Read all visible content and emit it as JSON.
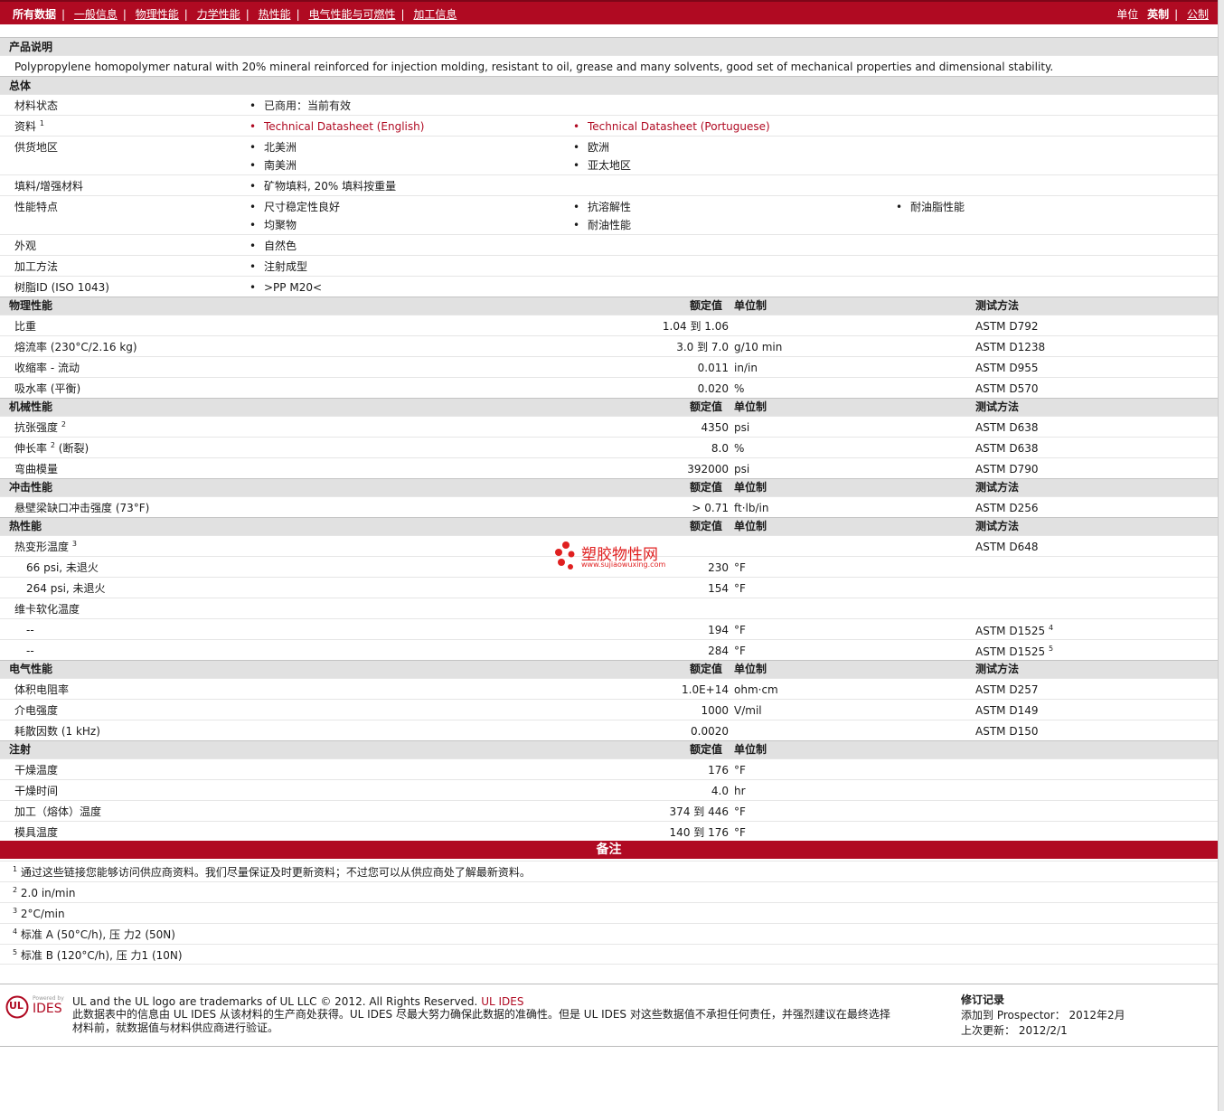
{
  "nav": {
    "all_data": "所有数据",
    "links": [
      "一般信息",
      "物理性能",
      "力学性能",
      "热性能",
      "电气性能与可燃性",
      "加工信息"
    ],
    "unit_label": "单位",
    "unit_english": "英制",
    "unit_metric": "公制"
  },
  "product": {
    "heading": "产品说明",
    "description": "Polypropylene homopolymer natural with 20% mineral reinforced for injection molding, resistant to oil, grease and many solvents, good set of mechanical properties and dimensional stability."
  },
  "general": {
    "heading": "总体",
    "status_label": "材料状态",
    "status": "已商用：当前有效",
    "docs_label": "资料",
    "docs_sup": "1",
    "doc1": "Technical Datasheet (English)",
    "doc2": "Technical Datasheet (Portuguese)",
    "region_label": "供货地区",
    "regions": [
      "北美洲",
      "欧洲",
      "南美洲",
      "亚太地区"
    ],
    "filler_label": "填料/增强材料",
    "filler": "矿物填料, 20% 填料按重量",
    "features_label": "性能特点",
    "features": [
      "尺寸稳定性良好",
      "抗溶解性",
      "耐油脂性能",
      "均聚物",
      "耐油性能"
    ],
    "appearance_label": "外观",
    "appearance": "自然色",
    "method_label": "加工方法",
    "method": "注射成型",
    "resin_label": "树脂ID (ISO 1043)",
    "resin": ">PP M20<"
  },
  "cols": {
    "nominal": "额定值",
    "unit": "单位制",
    "test": "测试方法"
  },
  "physical": {
    "heading": "物理性能",
    "rows": [
      {
        "name": "比重",
        "value": "1.04 到  1.06",
        "unit": "",
        "test": "ASTM D792"
      },
      {
        "name": "熔流率  (230°C/2.16 kg)",
        "value": "3.0 到  7.0",
        "unit": "g/10 min",
        "test": "ASTM D1238"
      },
      {
        "name": "收缩率  - 流动",
        "value": "0.011",
        "unit": "in/in",
        "test": "ASTM D955"
      },
      {
        "name": "吸水率  (平衡)",
        "value": "0.020",
        "unit": "%",
        "test": "ASTM D570"
      }
    ]
  },
  "mechanical": {
    "heading": "机械性能",
    "r1_name": "抗张强度",
    "r1_sup": "2",
    "r1_value": "4350",
    "r1_unit": "psi",
    "r1_test": "ASTM D638",
    "r2_name": "伸长率",
    "r2_sup": "2",
    "r2_suffix": "(断裂)",
    "r2_value": "8.0",
    "r2_unit": "%",
    "r2_test": "ASTM D638",
    "r3_name": "弯曲模量",
    "r3_value": "392000",
    "r3_unit": "psi",
    "r3_test": "ASTM D790"
  },
  "impact": {
    "heading": "冲击性能",
    "name": "悬壁梁缺口冲击强度  (73°F)",
    "value": "> 0.71",
    "unit": "ft·lb/in",
    "test": "ASTM D256"
  },
  "thermal": {
    "heading": "热性能",
    "hdt_name": "热变形温度",
    "hdt_sup": "3",
    "hdt_test": "ASTM D648",
    "hdt1_name": "66 psi, 未退火",
    "hdt1_value": "230",
    "hdt1_unit": "°F",
    "hdt2_name": "264 psi, 未退火",
    "hdt2_value": "154",
    "hdt2_unit": "°F",
    "vicat_name": "维卡软化温度",
    "v1_name": "--",
    "v1_value": "194",
    "v1_unit": "°F",
    "v1_test": "ASTM D1525",
    "v1_sup": "4",
    "v2_name": "--",
    "v2_value": "284",
    "v2_unit": "°F",
    "v2_test": "ASTM D1525",
    "v2_sup": "5"
  },
  "electrical": {
    "heading": "电气性能",
    "rows": [
      {
        "name": "体积电阻率",
        "value": "1.0E+14",
        "unit": "ohm·cm",
        "test": "ASTM D257"
      },
      {
        "name": "介电强度",
        "value": "1000",
        "unit": "V/mil",
        "test": "ASTM D149"
      },
      {
        "name": "耗散因数  (1 kHz)",
        "value": "0.0020",
        "unit": "",
        "test": "ASTM D150"
      }
    ]
  },
  "injection": {
    "heading": "注射",
    "rows": [
      {
        "name": "干燥温度",
        "value": "176",
        "unit": "°F"
      },
      {
        "name": "干燥时间",
        "value": "4.0",
        "unit": "hr"
      },
      {
        "name": "加工（熔体）温度",
        "value": "374 到  446",
        "unit": "°F"
      },
      {
        "name": "模具温度",
        "value": "140 到  176",
        "unit": "°F"
      }
    ]
  },
  "notes": {
    "heading": "备注",
    "items": [
      {
        "sup": "1",
        "text": "通过这些链接您能够访问供应商资料。我们尽量保证及时更新资料；不过您可以从供应商处了解最新资料。"
      },
      {
        "sup": "2",
        "text": "2.0 in/min"
      },
      {
        "sup": "3",
        "text": "2°C/min"
      },
      {
        "sup": "4",
        "text": "标准  A (50°C/h), 压  力2 (50N)"
      },
      {
        "sup": "5",
        "text": "标准  B (120°C/h), 压  力1 (10N)"
      }
    ]
  },
  "watermark": {
    "name": "塑胶物性网",
    "url": "www.sujiaowuxing.com"
  },
  "footer": {
    "logo_ul": "UL",
    "logo_powered": "Powered by",
    "logo_ides": "IDES",
    "trademark": "UL and the UL logo are trademarks of UL LLC © 2012. All Rights Reserved.",
    "ul_ides_link": "UL IDES",
    "disclaimer1": "此数据表中的信息由  UL IDES 从该材料的生产商处获得。UL IDES 尽最大努力确保此数据的准确性。但是  UL IDES 对这些数据值不承担任何责任，并强烈建议在最终选择",
    "disclaimer2": "材料前，就数据值与材料供应商进行验证。",
    "rev_heading": "修订记录",
    "added": "添加到  Prospector：   2012年2月",
    "updated": "上次更新：    2012/2/1"
  }
}
